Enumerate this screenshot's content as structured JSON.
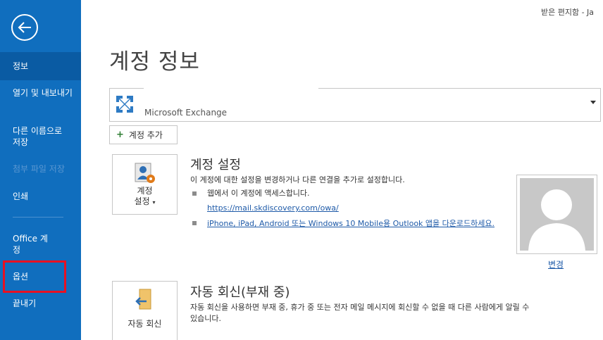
{
  "window": {
    "top_right": "받은 편지함 - Ja"
  },
  "sidebar": {
    "items": [
      {
        "label": "정보"
      },
      {
        "label": "열기 및 내보내기"
      },
      {
        "label": "다른 이름으로 저장"
      },
      {
        "label": "첨부 파일 저장"
      },
      {
        "label": "인쇄"
      },
      {
        "label": "Office 계정"
      },
      {
        "label": "옵션"
      },
      {
        "label": "끝내기"
      }
    ]
  },
  "main": {
    "title": "계정 정보",
    "account": {
      "type": "Microsoft Exchange"
    },
    "add_account_label": "계정 추가",
    "account_settings": {
      "tile_label_1": "계정",
      "tile_label_2": "설정",
      "title": "계정 설정",
      "description": "이 계정에 대한 설정을 변경하거나 다른 연결을 추가로 설정합니다.",
      "web_access_text": "웹에서 이 계정에 액세스합니다.",
      "owa_link": "https://mail.skdiscovery.com/owa/",
      "mobile_link": "iPhone, iPad, Android 또는 Windows 10 Mobile용 Outlook 앱을 다운로드하세요."
    },
    "photo_change_label": "변경",
    "auto_reply": {
      "tile_label": "자동 회신",
      "title": "자동 회신(부재 중)",
      "description_1": "자동 회신을 사용하면 부재 중, 휴가 중 또는 전자 메일 메시지에 회신할 수 없을 때 다른 사람에게 알릴 수",
      "description_2": "있습니다."
    }
  },
  "colors": {
    "sidebar": "#106ebe",
    "active_item": "#0a5ba3",
    "highlight": "#e81123",
    "link": "#1e5aa8"
  }
}
